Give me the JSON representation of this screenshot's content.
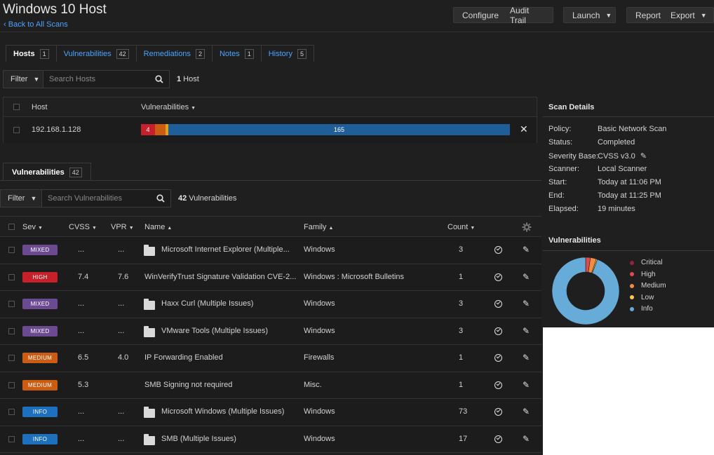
{
  "header": {
    "title": "Windows 10 Host",
    "back_link": "Back to All Scans",
    "buttons": {
      "configure": "Configure",
      "audit_trail": "Audit Trail",
      "launch": "Launch",
      "report": "Report",
      "export": "Export"
    }
  },
  "tabs": [
    {
      "label": "Hosts",
      "count": "1"
    },
    {
      "label": "Vulnerabilities",
      "count": "42"
    },
    {
      "label": "Remediations",
      "count": "2"
    },
    {
      "label": "Notes",
      "count": "1"
    },
    {
      "label": "History",
      "count": "5"
    }
  ],
  "hosts_filter": {
    "filter_label": "Filter",
    "placeholder": "Search Hosts",
    "count_num": "1",
    "count_text": " Host"
  },
  "hosts_table": {
    "col_host": "Host",
    "col_vulns": "Vulnerabilities",
    "row": {
      "host": "192.168.1.128",
      "bar": {
        "critical": 0,
        "high": 4,
        "medium": 5,
        "low": 1,
        "info": 165
      },
      "high_label": "4",
      "info_label": "165"
    }
  },
  "vulns_tab": {
    "label": "Vulnerabilities",
    "count": "42"
  },
  "vulns_filter": {
    "filter_label": "Filter",
    "placeholder": "Search Vulnerabilities",
    "count_num": "42",
    "count_text": " Vulnerabilities"
  },
  "vulns_table": {
    "headers": {
      "sev": "Sev",
      "cvss": "CVSS",
      "vpr": "VPR",
      "name": "Name",
      "family": "Family",
      "count": "Count"
    },
    "rows": [
      {
        "sev": "MIXED",
        "cvss": "...",
        "vpr": "...",
        "folder": true,
        "name": "Microsoft Internet Explorer (Multiple...",
        "family": "Windows",
        "count": "3"
      },
      {
        "sev": "HIGH",
        "cvss": "7.4",
        "vpr": "7.6",
        "folder": false,
        "name": "WinVerifyTrust Signature Validation CVE-2...",
        "family": "Windows : Microsoft Bulletins",
        "count": "1"
      },
      {
        "sev": "MIXED",
        "cvss": "...",
        "vpr": "...",
        "folder": true,
        "name": "Haxx Curl (Multiple Issues)",
        "family": "Windows",
        "count": "3"
      },
      {
        "sev": "MIXED",
        "cvss": "...",
        "vpr": "...",
        "folder": true,
        "name": "VMware Tools (Multiple Issues)",
        "family": "Windows",
        "count": "3"
      },
      {
        "sev": "MEDIUM",
        "cvss": "6.5",
        "vpr": "4.0",
        "folder": false,
        "name": "IP Forwarding Enabled",
        "family": "Firewalls",
        "count": "1"
      },
      {
        "sev": "MEDIUM",
        "cvss": "5.3",
        "vpr": "",
        "folder": false,
        "name": "SMB Signing not required",
        "family": "Misc.",
        "count": "1"
      },
      {
        "sev": "INFO",
        "cvss": "...",
        "vpr": "...",
        "folder": true,
        "name": "Microsoft Windows (Multiple Issues)",
        "family": "Windows",
        "count": "73"
      },
      {
        "sev": "INFO",
        "cvss": "...",
        "vpr": "...",
        "folder": true,
        "name": "SMB (Multiple Issues)",
        "family": "Windows",
        "count": "17"
      }
    ]
  },
  "scan_details": {
    "title": "Scan Details",
    "rows": [
      {
        "k": "Policy:",
        "v": "Basic Network Scan"
      },
      {
        "k": "Status:",
        "v": "Completed"
      },
      {
        "k": "Severity Base:",
        "v": "CVSS v3.0"
      },
      {
        "k": "Scanner:",
        "v": "Local Scanner"
      },
      {
        "k": "Start:",
        "v": "Today at 11:06 PM"
      },
      {
        "k": "End:",
        "v": "Today at 11:25 PM"
      },
      {
        "k": "Elapsed:",
        "v": "19 minutes"
      }
    ]
  },
  "vuln_chart": {
    "title": "Vulnerabilities",
    "legend": [
      "Critical",
      "High",
      "Medium",
      "Low",
      "Info"
    ]
  },
  "colors": {
    "critical": "#91243e",
    "high": "#dd4b50",
    "medium": "#f18c43",
    "low": "#f8c851",
    "info": "#67acd8",
    "mixed": "#6c4a92",
    "info_badge": "#1f6fbf",
    "medium_badge": "#cc5c12",
    "high_badge": "#c8202a",
    "link": "#4da3ff"
  },
  "chart_data": {
    "type": "pie",
    "labels": [
      "Critical",
      "High",
      "Medium",
      "Low",
      "Info"
    ],
    "values": [
      0,
      4,
      5,
      1,
      165
    ]
  }
}
